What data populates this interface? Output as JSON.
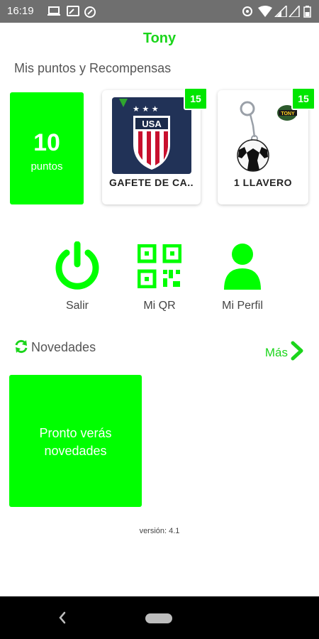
{
  "status_bar": {
    "time": "16:19"
  },
  "app_title": "Tony",
  "section_title": "Mis puntos y Recompensas",
  "points": {
    "value": "10",
    "label": "puntos"
  },
  "rewards": [
    {
      "name": "GAFETE DE CA..",
      "badge": "15",
      "image": "usa-soccer-crest-image"
    },
    {
      "name": "1 LLAVERO",
      "badge": "15",
      "image": "soccer-ball-keychain-image"
    }
  ],
  "actions": [
    {
      "label": "Salir",
      "icon": "power-icon"
    },
    {
      "label": "Mi QR",
      "icon": "qr-code-icon"
    },
    {
      "label": "Mi Perfil",
      "icon": "user-icon"
    }
  ],
  "news": {
    "title": "Novedades",
    "more_label": "Más",
    "placeholder": "Pronto verás novedades"
  },
  "version": "versión: 4.1",
  "colors": {
    "accent": "#00ff00",
    "accent_text": "#1bd51b",
    "status_bar": "#6f6f6f"
  }
}
